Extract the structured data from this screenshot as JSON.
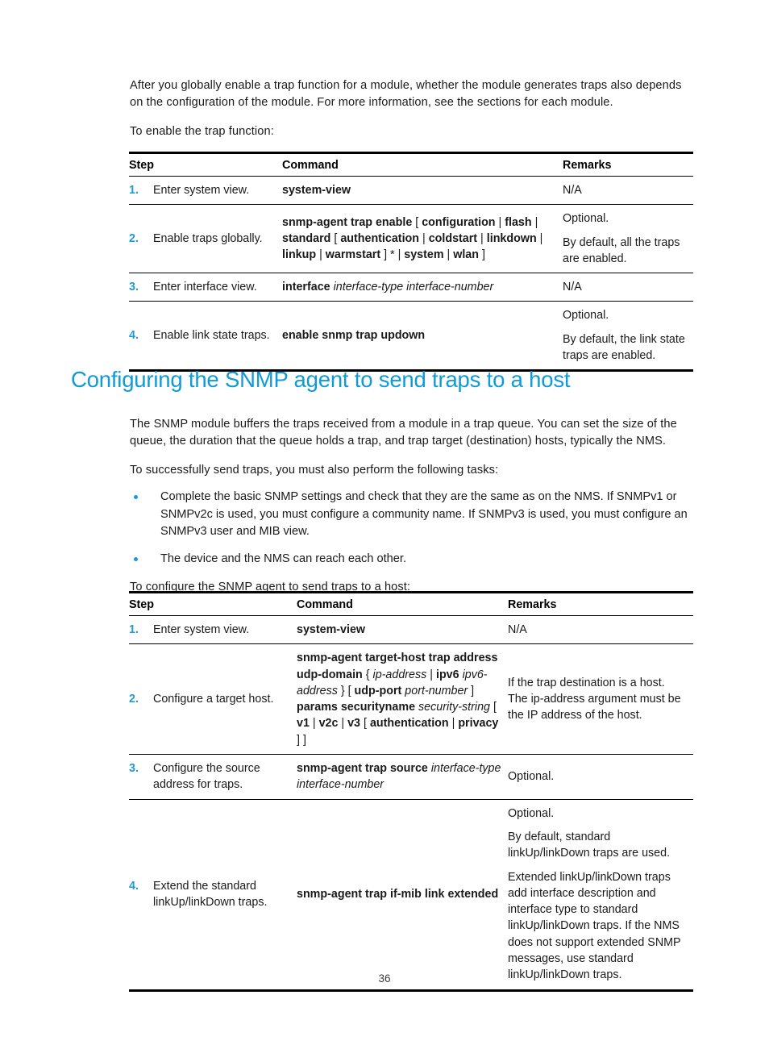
{
  "intro": {
    "paragraph1": "After you globally enable a trap function for a module, whether the module generates traps also depends on the configuration of the module. For more information, see the sections for each module.",
    "paragraph2": "To enable the trap function:"
  },
  "table_enable_trap": {
    "headers": {
      "step": "Step",
      "command": "Command",
      "remarks": "Remarks"
    },
    "rows": [
      {
        "num": "1.",
        "step": "Enter system view.",
        "command_parts": [
          {
            "text": "system-view",
            "style": "bold"
          }
        ],
        "remarks": [
          "N/A"
        ]
      },
      {
        "num": "2.",
        "step": "Enable traps globally.",
        "command_parts": [
          {
            "text": "snmp-agent trap enable",
            "style": "bold"
          },
          {
            "text": " [ ",
            "style": "plain"
          },
          {
            "text": "configuration",
            "style": "bold"
          },
          {
            "text": " | ",
            "style": "plain"
          },
          {
            "text": "flash",
            "style": "bold"
          },
          {
            "text": " | ",
            "style": "plain"
          },
          {
            "text": "standard",
            "style": "bold"
          },
          {
            "text": " [ ",
            "style": "plain"
          },
          {
            "text": "authentication",
            "style": "bold"
          },
          {
            "text": " | ",
            "style": "plain"
          },
          {
            "text": "coldstart",
            "style": "bold"
          },
          {
            "text": " | ",
            "style": "plain"
          },
          {
            "text": "linkdown",
            "style": "bold"
          },
          {
            "text": " | ",
            "style": "plain"
          },
          {
            "text": "linkup",
            "style": "bold"
          },
          {
            "text": " | ",
            "style": "plain"
          },
          {
            "text": "warmstart",
            "style": "bold"
          },
          {
            "text": " ] * | ",
            "style": "plain"
          },
          {
            "text": "system",
            "style": "bold"
          },
          {
            "text": " | ",
            "style": "plain"
          },
          {
            "text": "wlan",
            "style": "bold"
          },
          {
            "text": " ]",
            "style": "plain"
          }
        ],
        "remarks": [
          "Optional.",
          "By default, all the traps are enabled."
        ]
      },
      {
        "num": "3.",
        "step": "Enter interface view.",
        "command_parts": [
          {
            "text": "interface",
            "style": "bold"
          },
          {
            "text": " ",
            "style": "plain"
          },
          {
            "text": "interface-type interface-number",
            "style": "italic"
          }
        ],
        "remarks": [
          "N/A"
        ]
      },
      {
        "num": "4.",
        "step": "Enable link state traps.",
        "command_parts": [
          {
            "text": "enable snmp trap updown",
            "style": "bold"
          }
        ],
        "remarks": [
          "Optional.",
          "By default, the link state traps are enabled."
        ]
      }
    ]
  },
  "section": {
    "heading": "Configuring the SNMP agent to send traps to a host",
    "paragraph1": "The SNMP module buffers the traps received from a module in a trap queue. You can set the size of the queue, the duration that the queue holds a trap, and trap target (destination) hosts, typically the NMS.",
    "paragraph2": "To successfully send traps, you must also perform the following tasks:",
    "bullets": [
      "Complete the basic SNMP settings and check that they are the same as on the NMS. If SNMPv1 or SNMPv2c is used, you must configure a community name. If SNMPv3 is used, you must configure an SNMPv3 user and MIB view.",
      "The device and the NMS can reach each other."
    ],
    "paragraph3": "To configure the SNMP agent to send traps to a host:"
  },
  "table_send_traps": {
    "headers": {
      "step": "Step",
      "command": "Command",
      "remarks": "Remarks"
    },
    "rows": [
      {
        "num": "1.",
        "step": "Enter system view.",
        "command_parts": [
          {
            "text": "system-view",
            "style": "bold"
          }
        ],
        "remarks": [
          "N/A"
        ]
      },
      {
        "num": "2.",
        "step": "Configure a target host.",
        "command_parts": [
          {
            "text": "snmp-agent target-host trap address udp-domain",
            "style": "bold"
          },
          {
            "text": " { ",
            "style": "plain"
          },
          {
            "text": "ip-address",
            "style": "italic"
          },
          {
            "text": " | ",
            "style": "plain"
          },
          {
            "text": "ipv6",
            "style": "bold"
          },
          {
            "text": " ",
            "style": "plain"
          },
          {
            "text": "ipv6-address",
            "style": "italic"
          },
          {
            "text": " } [ ",
            "style": "plain"
          },
          {
            "text": "udp-port",
            "style": "bold"
          },
          {
            "text": " ",
            "style": "plain"
          },
          {
            "text": "port-number",
            "style": "italic"
          },
          {
            "text": " ] ",
            "style": "plain"
          },
          {
            "text": "params securityname",
            "style": "bold"
          },
          {
            "text": " ",
            "style": "plain"
          },
          {
            "text": "security-string",
            "style": "italic"
          },
          {
            "text": " [ ",
            "style": "plain"
          },
          {
            "text": "v1",
            "style": "bold"
          },
          {
            "text": " | ",
            "style": "plain"
          },
          {
            "text": "v2c",
            "style": "bold"
          },
          {
            "text": " | ",
            "style": "plain"
          },
          {
            "text": "v3",
            "style": "bold"
          },
          {
            "text": " [ ",
            "style": "plain"
          },
          {
            "text": "authentication",
            "style": "bold"
          },
          {
            "text": " | ",
            "style": "plain"
          },
          {
            "text": "privacy",
            "style": "bold"
          },
          {
            "text": " ] ]",
            "style": "plain"
          }
        ],
        "remarks": [
          "If the trap destination is a host. The ip-address argument must be the IP address of the host."
        ]
      },
      {
        "num": "3.",
        "step": "Configure the source address for traps.",
        "command_parts": [
          {
            "text": "snmp-agent trap source",
            "style": "bold"
          },
          {
            "text": " ",
            "style": "plain"
          },
          {
            "text": "interface-type interface-number",
            "style": "italic"
          }
        ],
        "remarks": [
          "Optional."
        ]
      },
      {
        "num": "4.",
        "step": "Extend the standard linkUp/linkDown traps.",
        "command_parts": [
          {
            "text": "snmp-agent trap if-mib link extended",
            "style": "bold"
          }
        ],
        "remarks": [
          "Optional.",
          "By default, standard linkUp/linkDown traps are used.",
          "Extended linkUp/linkDown traps add interface description and interface type to standard linkUp/linkDown traps. If the NMS does not support extended SNMP messages, use standard linkUp/linkDown traps."
        ]
      }
    ]
  },
  "footer": {
    "page_number": "36"
  },
  "colors": {
    "accent": "#0f9bd7",
    "step_number": "#1f9ad6",
    "bullet": "#2196d4",
    "rule": "#000000"
  }
}
